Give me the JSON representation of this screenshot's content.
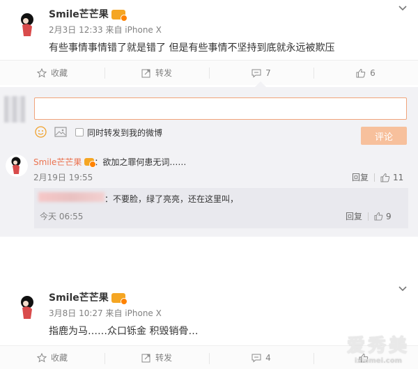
{
  "posts": [
    {
      "username": "Smile芒芒果",
      "meta": "2月3日 12:33 来自 iPhone X",
      "text": "有些事情事情错了就是错了 但是有些事情不坚持到底就永远被欺压",
      "actions": {
        "favorite": "收藏",
        "repost": "转发",
        "comments": "7",
        "likes": "6"
      }
    },
    {
      "username": "Smile芒芒果",
      "meta": "3月8日 10:27 来自 iPhone X",
      "text": "指鹿为马……众口铄金 积毁销骨…",
      "actions": {
        "favorite": "收藏",
        "repost": "转发",
        "comments": "4",
        "likes": ""
      }
    }
  ],
  "composer": {
    "also_repost_label": "同时转发到我的微博",
    "submit_label": "评论"
  },
  "comment": {
    "username": "Smile芒芒果",
    "text": "：欲加之罪何患无词……",
    "time": "2月19日 19:55",
    "reply_label": "回复",
    "likes": "11"
  },
  "reply": {
    "text": "：不要脸，绿了亮亮，还在这里叫，",
    "time": "今天 06:55",
    "reply_label": "回复",
    "likes": "9"
  },
  "watermark": {
    "main": "爱秀美",
    "sub": "ixiumei.com"
  },
  "colors": {
    "accent_orange": "#eb7350",
    "vip_gold": "#f5a623",
    "panel_bg": "#f2f2f5"
  }
}
